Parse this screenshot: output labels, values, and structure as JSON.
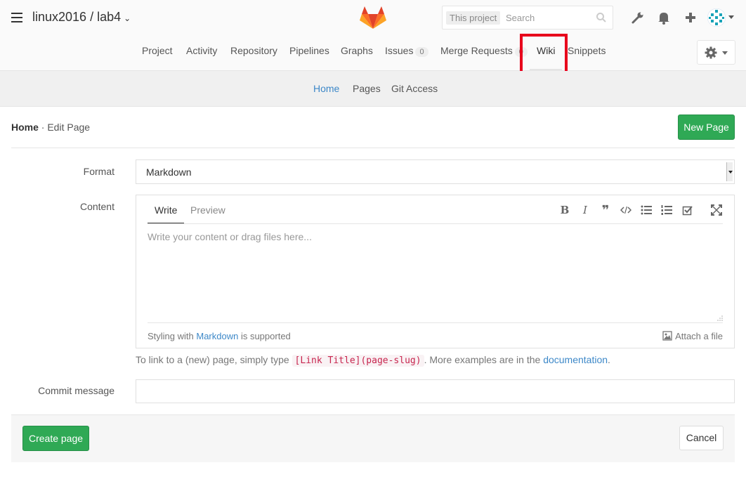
{
  "header": {
    "project_title": "linux2016 / lab4",
    "search_scope": "This project",
    "search_placeholder": "Search",
    "icons": [
      "menu-icon",
      "gitlab-logo",
      "search-icon",
      "admin-wrench-icon",
      "notifications-bell-icon",
      "new-plus-icon",
      "user-avatar"
    ]
  },
  "nav": {
    "items": [
      {
        "label": "Project"
      },
      {
        "label": "Activity"
      },
      {
        "label": "Repository"
      },
      {
        "label": "Pipelines"
      },
      {
        "label": "Graphs"
      },
      {
        "label": "Issues",
        "count": "0"
      },
      {
        "label": "Merge Requests",
        "count": "0"
      },
      {
        "label": "Wiki",
        "active": true
      },
      {
        "label": "Snippets"
      }
    ]
  },
  "subnav": {
    "items": [
      {
        "label": "Home",
        "active": true
      },
      {
        "label": "Pages"
      },
      {
        "label": "Git Access"
      }
    ]
  },
  "page": {
    "breadcrumb_title": "Home",
    "breadcrumb_action": " · Edit Page",
    "new_page_label": "New Page"
  },
  "form": {
    "format_label": "Format",
    "format_value": "Markdown",
    "content_label": "Content",
    "tab_write": "Write",
    "tab_preview": "Preview",
    "content_placeholder": "Write your content or drag files here...",
    "styling_prefix": "Styling with ",
    "styling_link": "Markdown",
    "styling_suffix": " is supported",
    "attach_label": "Attach a file",
    "hint_prefix": "To link to a (new) page, simply type ",
    "hint_code": "[Link Title](page-slug)",
    "hint_middle": ". More examples are in the ",
    "hint_link": "documentation",
    "hint_suffix": ".",
    "commit_label": "Commit message",
    "commit_value": "",
    "create_label": "Create page",
    "cancel_label": "Cancel"
  },
  "colors": {
    "accent_blue": "#3d88c8",
    "green": "#2fa955",
    "highlight_red": "#e8001c"
  }
}
